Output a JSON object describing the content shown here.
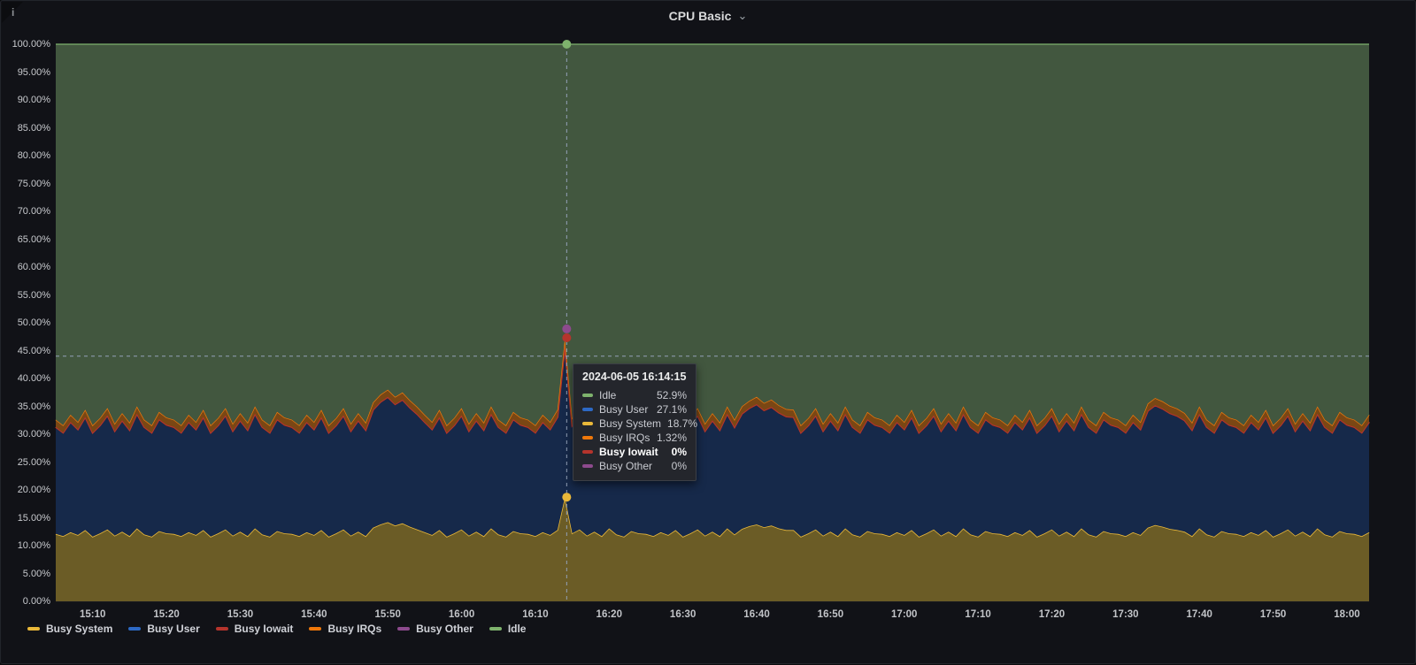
{
  "panel": {
    "title": "CPU Basic",
    "chevron": "⌄",
    "info_icon": "i"
  },
  "colors": {
    "background": "#111217",
    "panel_border": "#22252b",
    "grid": "rgba(255,255,255,0.07)",
    "crosshair": "#93a1b8",
    "axis_text": "#c8cace"
  },
  "chart_data": {
    "type": "area",
    "stacked": true,
    "title": "CPU Basic",
    "x_start": "15:05",
    "x_end": "18:03",
    "x_step_minutes": 1,
    "ylim": [
      0,
      100
    ],
    "grid": true,
    "legend_position": "bottom",
    "y_ticks": [
      "0.00%",
      "5.00%",
      "10.00%",
      "15.00%",
      "20.00%",
      "25.00%",
      "30.00%",
      "35.00%",
      "40.00%",
      "45.00%",
      "50.00%",
      "55.00%",
      "60.00%",
      "65.00%",
      "70.00%",
      "75.00%",
      "80.00%",
      "85.00%",
      "90.00%",
      "95.00%",
      "100.00%"
    ],
    "x_ticks": [
      {
        "label": "15:10",
        "min": 5
      },
      {
        "label": "15:20",
        "min": 15
      },
      {
        "label": "15:30",
        "min": 25
      },
      {
        "label": "15:40",
        "min": 35
      },
      {
        "label": "15:50",
        "min": 45
      },
      {
        "label": "16:00",
        "min": 55
      },
      {
        "label": "16:10",
        "min": 65
      },
      {
        "label": "16:20",
        "min": 75
      },
      {
        "label": "16:30",
        "min": 85
      },
      {
        "label": "16:40",
        "min": 95
      },
      {
        "label": "16:50",
        "min": 105
      },
      {
        "label": "17:00",
        "min": 115
      },
      {
        "label": "17:10",
        "min": 125
      },
      {
        "label": "17:20",
        "min": 135
      },
      {
        "label": "17:30",
        "min": 145
      },
      {
        "label": "17:40",
        "min": 155
      },
      {
        "label": "17:50",
        "min": 165
      },
      {
        "label": "18:00",
        "min": 175
      }
    ],
    "series": [
      {
        "name": "Busy System",
        "color": "#EAB839",
        "fill": "#6B5C26",
        "values": [
          12.1,
          11.7,
          12.4,
          11.9,
          12.8,
          11.6,
          12.2,
          12.9,
          11.8,
          12.5,
          11.7,
          13.1,
          12.0,
          11.6,
          12.6,
          12.2,
          12.1,
          11.7,
          12.4,
          11.9,
          12.8,
          11.6,
          12.2,
          12.9,
          11.8,
          12.5,
          11.7,
          13.1,
          12.0,
          11.6,
          12.6,
          12.2,
          12.1,
          11.7,
          12.4,
          11.9,
          12.8,
          11.6,
          12.2,
          12.9,
          11.8,
          12.5,
          11.7,
          13.2,
          13.8,
          14.2,
          13.6,
          14.0,
          13.4,
          12.9,
          12.4,
          11.9,
          12.8,
          11.6,
          12.2,
          12.9,
          11.8,
          12.5,
          11.7,
          13.1,
          12.0,
          11.6,
          12.6,
          12.2,
          12.1,
          11.7,
          12.4,
          11.9,
          12.8,
          18.7,
          12.2,
          12.9,
          11.8,
          12.5,
          11.7,
          13.1,
          12.0,
          11.6,
          12.6,
          12.2,
          12.1,
          11.7,
          12.4,
          11.9,
          12.8,
          11.6,
          12.2,
          12.9,
          11.8,
          12.5,
          11.7,
          13.1,
          12.0,
          13.0,
          13.5,
          13.8,
          13.3,
          13.6,
          13.1,
          12.8,
          12.8,
          11.6,
          12.2,
          12.9,
          11.8,
          12.5,
          11.7,
          13.1,
          12.0,
          11.6,
          12.6,
          12.2,
          12.1,
          11.7,
          12.4,
          11.9,
          12.8,
          11.6,
          12.2,
          12.9,
          11.8,
          12.5,
          11.7,
          13.1,
          12.0,
          11.6,
          12.6,
          12.2,
          12.1,
          11.7,
          12.4,
          11.9,
          12.8,
          11.6,
          12.2,
          12.9,
          11.8,
          12.5,
          11.7,
          13.1,
          12.0,
          11.6,
          12.6,
          12.2,
          12.1,
          11.7,
          12.4,
          11.9,
          13.2,
          13.7,
          13.4,
          13.0,
          12.8,
          12.5,
          11.7,
          13.1,
          12.0,
          11.6,
          12.6,
          12.2,
          12.1,
          11.7,
          12.4,
          11.9,
          12.8,
          11.6,
          12.2,
          12.9,
          11.8,
          12.5,
          11.7,
          13.1,
          12.0,
          11.6,
          12.6,
          12.2,
          12.1,
          11.7,
          12.4
        ]
      },
      {
        "name": "Busy User",
        "color": "#2D69C5",
        "fill": "#16294A",
        "values": [
          19.0,
          18.4,
          19.6,
          18.8,
          20.1,
          18.5,
          19.2,
          20.3,
          18.6,
          19.8,
          18.9,
          20.4,
          19.1,
          18.5,
          19.9,
          19.3,
          19.0,
          18.4,
          19.6,
          18.8,
          20.1,
          18.5,
          19.2,
          20.3,
          18.6,
          19.8,
          18.9,
          20.4,
          19.1,
          18.5,
          19.9,
          19.3,
          19.0,
          18.4,
          19.6,
          18.8,
          20.1,
          18.5,
          19.2,
          20.3,
          18.6,
          19.8,
          18.9,
          21.0,
          21.8,
          22.3,
          21.6,
          22.0,
          21.2,
          20.5,
          19.6,
          18.8,
          20.1,
          18.5,
          19.2,
          20.3,
          18.6,
          19.8,
          18.9,
          20.4,
          19.1,
          18.5,
          19.9,
          19.3,
          19.0,
          18.4,
          19.6,
          18.8,
          20.1,
          27.1,
          19.2,
          20.3,
          18.6,
          19.8,
          18.9,
          20.4,
          19.1,
          18.5,
          19.9,
          19.3,
          19.0,
          18.4,
          19.6,
          18.8,
          20.1,
          18.5,
          19.2,
          20.3,
          18.6,
          19.8,
          18.9,
          20.4,
          19.1,
          20.5,
          21.0,
          21.4,
          20.8,
          21.1,
          20.6,
          20.2,
          20.1,
          18.5,
          19.2,
          20.3,
          18.6,
          19.8,
          18.9,
          20.4,
          19.1,
          18.5,
          19.9,
          19.3,
          19.0,
          18.4,
          19.6,
          18.8,
          20.1,
          18.5,
          19.2,
          20.3,
          18.6,
          19.8,
          18.9,
          20.4,
          19.1,
          18.5,
          19.9,
          19.3,
          19.0,
          18.4,
          19.6,
          18.8,
          20.1,
          18.5,
          19.2,
          20.3,
          18.6,
          19.8,
          18.9,
          20.4,
          19.1,
          18.5,
          19.9,
          19.3,
          19.0,
          18.4,
          19.6,
          18.8,
          20.8,
          21.3,
          21.0,
          20.6,
          20.3,
          19.8,
          18.9,
          20.4,
          19.1,
          18.5,
          19.9,
          19.3,
          19.0,
          18.4,
          19.6,
          18.8,
          20.1,
          18.5,
          19.2,
          20.3,
          18.6,
          19.8,
          18.9,
          20.4,
          19.1,
          18.5,
          19.9,
          19.3,
          19.0,
          18.4,
          19.6
        ]
      },
      {
        "name": "Busy Iowait",
        "color": "#B5342C",
        "fill": "#6B241C",
        "constant": 0.2
      },
      {
        "name": "Busy IRQs",
        "color": "#F0780A",
        "fill": "#7A4714",
        "constant": 1.3
      },
      {
        "name": "Busy Other",
        "color": "#8D4A8D",
        "fill": "#3A2438",
        "constant": 0
      },
      {
        "name": "Idle",
        "color": "#7EB26D",
        "fill": "#42573F",
        "derived": "remainder"
      }
    ],
    "legend": [
      "Busy System",
      "Busy User",
      "Busy Iowait",
      "Busy IRQs",
      "Busy Other",
      "Idle"
    ]
  },
  "tooltip": {
    "timestamp": "2024-06-05 16:14:15",
    "rows": [
      {
        "name": "Idle",
        "value": "52.9%",
        "color": "#7EB26D",
        "bold": false
      },
      {
        "name": "Busy User",
        "value": "27.1%",
        "color": "#2D69C5",
        "bold": false
      },
      {
        "name": "Busy System",
        "value": "18.7%",
        "color": "#EAB839",
        "bold": false
      },
      {
        "name": "Busy IRQs",
        "value": "1.32%",
        "color": "#F0780A",
        "bold": false
      },
      {
        "name": "Busy Iowait",
        "value": "0%",
        "color": "#B5342C",
        "bold": true
      },
      {
        "name": "Busy Other",
        "value": "0%",
        "color": "#8D4A8D",
        "bold": false
      }
    ]
  },
  "hover": {
    "time_minutes_from_start": 69.25,
    "crosshair_y_pct": 44.0,
    "dots": [
      {
        "series": "Idle",
        "color": "#7EB26D",
        "pct": 100
      },
      {
        "series": "Busy Other",
        "color": "#8D4A8D",
        "pct": 48.9
      },
      {
        "series": "Busy Iowait",
        "color": "#B5342C",
        "pct": 47.3
      },
      {
        "series": "Busy System",
        "color": "#EAB839",
        "pct": 18.7
      }
    ]
  }
}
